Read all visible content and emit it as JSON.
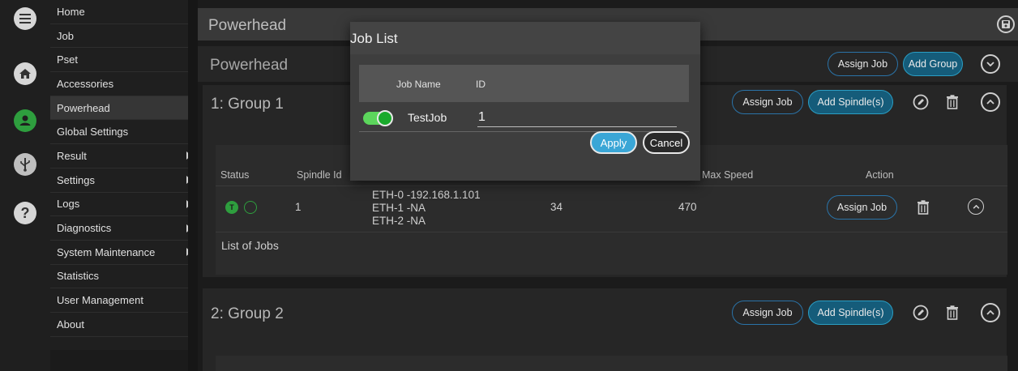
{
  "sidebar": {
    "items": [
      {
        "label": "Home",
        "arrow": false
      },
      {
        "label": "Job",
        "arrow": false
      },
      {
        "label": "Pset",
        "arrow": false
      },
      {
        "label": "Accessories",
        "arrow": false
      },
      {
        "label": "Powerhead",
        "arrow": false,
        "active": true
      },
      {
        "label": "Global Settings",
        "arrow": false
      },
      {
        "label": "Result",
        "arrow": true
      },
      {
        "label": "Settings",
        "arrow": true
      },
      {
        "label": "Logs",
        "arrow": true
      },
      {
        "label": "Diagnostics",
        "arrow": true
      },
      {
        "label": "System Maintenance",
        "arrow": true
      },
      {
        "label": "Statistics",
        "arrow": false
      },
      {
        "label": "User Management",
        "arrow": false
      },
      {
        "label": "About",
        "arrow": false
      }
    ]
  },
  "rail": {
    "icons": [
      "menu-icon",
      "home-icon",
      "user-icon",
      "usb-icon",
      "help-icon"
    ],
    "accent_green": "#2e9e3e"
  },
  "topbar": {
    "title": "Powerhead"
  },
  "subhead": {
    "title": "Powerhead",
    "assign_job": "Assign Job",
    "add_group": "Add Group"
  },
  "group1": {
    "title": "1: Group 1",
    "assign_job": "Assign Job",
    "add_spindle": "Add Spindle(s)",
    "table": {
      "headers": {
        "status": "Status",
        "spindle_id": "Spindle Id",
        "max_speed": "Max Speed",
        "action": "Action"
      },
      "row": {
        "spindle_id": "1",
        "eth0": "ETH-0 -192.168.1.101",
        "eth1": "ETH-1 -NA",
        "eth2": "ETH-2 -NA",
        "value": "34",
        "max_speed": "470",
        "assign_job": "Assign Job"
      },
      "list_of_jobs": "List of Jobs"
    }
  },
  "group2": {
    "title": "2: Group 2",
    "assign_job": "Assign Job",
    "add_spindle": "Add Spindle(s)"
  },
  "dialog": {
    "title": "Job List",
    "headers": {
      "job_name": "Job Name",
      "id": "ID"
    },
    "row": {
      "job_name": "TestJob",
      "id": "1",
      "enabled": true
    },
    "apply": "Apply",
    "cancel": "Cancel"
  },
  "colors": {
    "accent_blue": "#2a9ec4",
    "toggle_green": "#1aaa2c"
  }
}
